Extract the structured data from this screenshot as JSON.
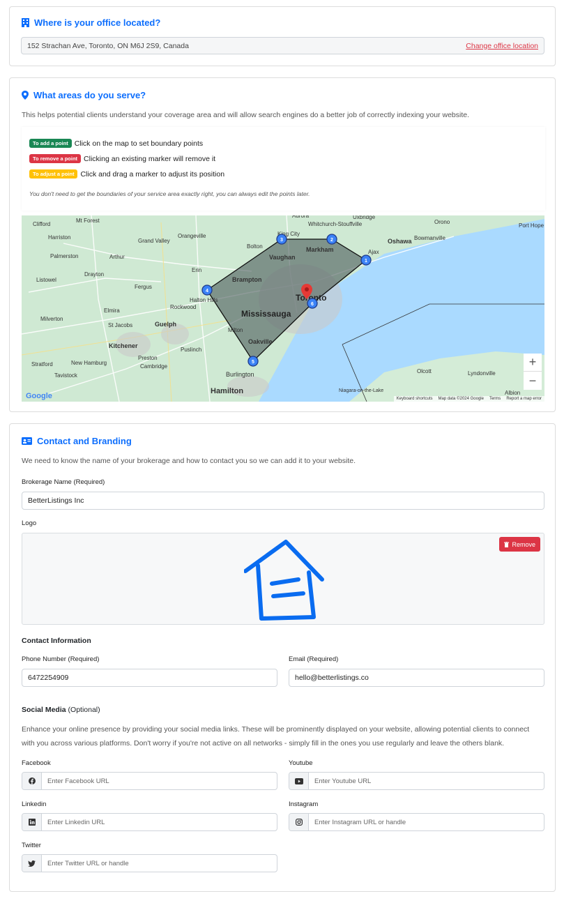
{
  "office": {
    "title": "Where is your office located?",
    "address": "152 Strachan Ave, Toronto, ON M6J 2S9, Canada",
    "change_link": "Change office location"
  },
  "areas": {
    "title": "What areas do you serve?",
    "description": "This helps potential clients understand your coverage area and will allow search engines do a better job of correctly indexing your website.",
    "instructions": [
      {
        "badge": "To add a point",
        "text": "Click on the map to set boundary points",
        "color": "#198754"
      },
      {
        "badge": "To remove a point",
        "text": "Clicking an existing marker will remove it",
        "color": "#dc3545"
      },
      {
        "badge": "To adjust a point",
        "text": "Click and drag a marker to adjust its position",
        "color": "#ffc107"
      }
    ],
    "note": "You don't need to get the boundaries of your service area exactly right, you can always edit the points later.",
    "map": {
      "places": [
        "Clifford",
        "Mt Forest",
        "Harriston",
        "Grand Valley",
        "Orangeville",
        "Palmerston",
        "Arthur",
        "Listowel",
        "Drayton",
        "Fergus",
        "Erin",
        "Elmira",
        "Rockwood",
        "Milverton",
        "St Jacobs",
        "Guelph",
        "Kitchener",
        "Puslinch",
        "Preston",
        "Cambridge",
        "New Hamburg",
        "Stratford",
        "Tavistock",
        "Halton Hills",
        "Milton",
        "Oakville",
        "Burlington",
        "Hamilton",
        "Mississauga",
        "Brampton",
        "Toronto",
        "Vaughan",
        "Markham",
        "King City",
        "Bolton",
        "Whitchurch-Stouffville",
        "Aurora",
        "Uxbridge",
        "Ajax",
        "Oshawa",
        "Bowmanville",
        "Orono",
        "Port Hope",
        "Olcott",
        "Lyndonville",
        "Albion",
        "Niagara-on-the-Lake"
      ],
      "markers": [
        "1",
        "2",
        "3",
        "4",
        "5",
        "6"
      ],
      "attribution": [
        "Keyboard shortcuts",
        "Map data ©2024 Google",
        "Terms",
        "Report a map error"
      ],
      "google_logo": "Google",
      "zoom_in": "+",
      "zoom_out": "−",
      "water_color": "#aadaff",
      "land_color": "#c8e8cf",
      "polygon_color": "#4a5a5a"
    }
  },
  "contact": {
    "title": "Contact and Branding",
    "description": "We need to know the name of your brokerage and how to contact you so we can add it to your website.",
    "brokerage_label": "Brokerage Name (Required)",
    "brokerage_value": "BetterListings Inc",
    "logo_label": "Logo",
    "remove_label": "Remove",
    "contact_info_heading": "Contact Information",
    "phone_label": "Phone Number (Required)",
    "phone_value": "6472254909",
    "email_label": "Email (Required)",
    "email_value": "hello@betterlistings.co",
    "social_heading": "Social Media",
    "social_optional": "(Optional)",
    "social_description": "Enhance your online presence by providing your social media links. These will be prominently displayed on your website, allowing potential clients to connect with you across various platforms. Don't worry if you're not active on all networks - simply fill in the ones you use regularly and leave the others blank.",
    "facebook_label": "Facebook",
    "facebook_placeholder": "Enter Facebook URL",
    "youtube_label": "Youtube",
    "youtube_placeholder": "Enter Youtube URL",
    "linkedin_label": "Linkedin",
    "linkedin_placeholder": "Enter Linkedin URL",
    "instagram_label": "Instagram",
    "instagram_placeholder": "Enter Instagram URL or handle",
    "twitter_label": "Twitter",
    "twitter_placeholder": "Enter Twitter URL or handle"
  },
  "colors": {
    "accent": "#0d6efd",
    "danger": "#dc3545"
  }
}
